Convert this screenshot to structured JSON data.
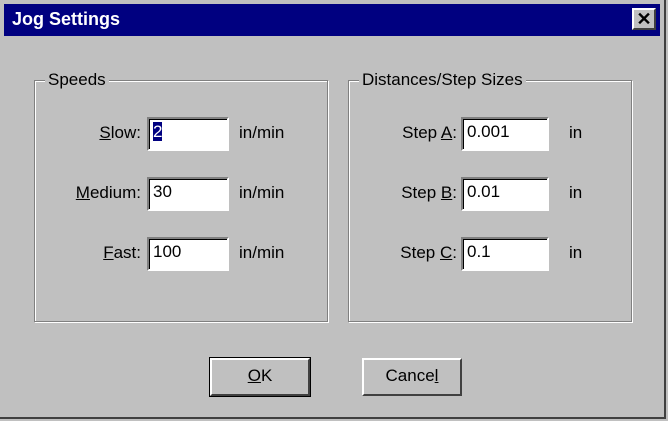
{
  "window": {
    "title": "Jog Settings",
    "close_glyph": "✕"
  },
  "speeds": {
    "legend": "Speeds",
    "rows": [
      {
        "label_pre": "",
        "label_u": "S",
        "label_post": "low:",
        "value": "2",
        "unit": "in/min"
      },
      {
        "label_pre": "",
        "label_u": "M",
        "label_post": "edium:",
        "value": "30",
        "unit": "in/min"
      },
      {
        "label_pre": "",
        "label_u": "F",
        "label_post": "ast:",
        "value": "100",
        "unit": "in/min"
      }
    ]
  },
  "distances": {
    "legend": "Distances/Step Sizes",
    "rows": [
      {
        "label_pre": "Step ",
        "label_u": "A",
        "label_post": ":",
        "value": "0.001",
        "unit": "in"
      },
      {
        "label_pre": "Step ",
        "label_u": "B",
        "label_post": ":",
        "value": "0.01",
        "unit": "in"
      },
      {
        "label_pre": "Step ",
        "label_u": "C",
        "label_post": ":",
        "value": "0.1",
        "unit": "in"
      }
    ]
  },
  "buttons": {
    "ok_u": "O",
    "ok_post": "K",
    "cancel_pre": "Cance",
    "cancel_u": "l"
  }
}
